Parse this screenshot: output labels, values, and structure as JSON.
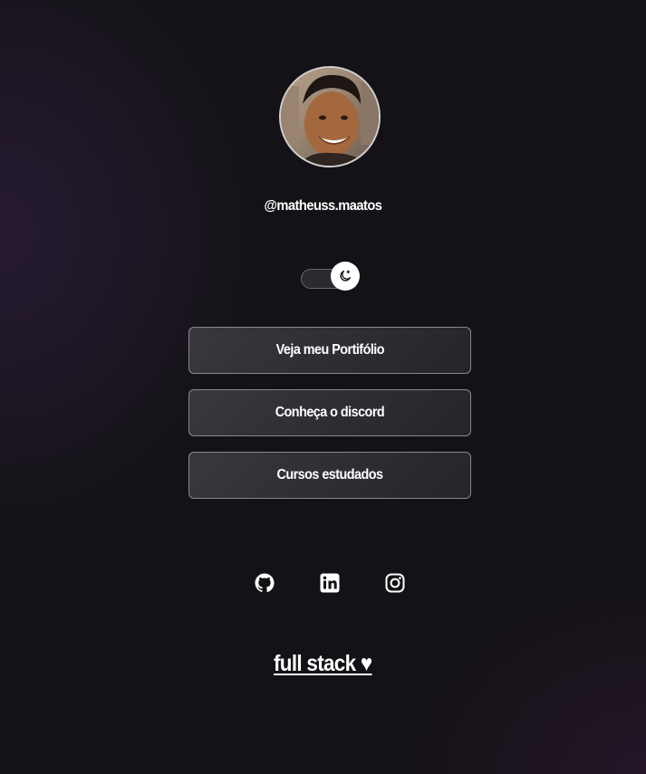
{
  "profile": {
    "username": "@matheuss.maatos",
    "avatar_alt": "profile photo"
  },
  "theme_toggle": {
    "icon": "moon-icon",
    "state": "dark"
  },
  "links": [
    {
      "label": "Veja meu Portifólio"
    },
    {
      "label": "Conheça o discord"
    },
    {
      "label": "Cursos estudados"
    }
  ],
  "social": [
    {
      "icon": "github-icon"
    },
    {
      "icon": "linkedin-icon"
    },
    {
      "icon": "instagram-icon"
    }
  ],
  "footer": {
    "text": "full stack ♥"
  },
  "colors": {
    "background": "#141216",
    "text": "#ffffff",
    "button_border": "#8a888e",
    "button_fill": "#333137"
  }
}
